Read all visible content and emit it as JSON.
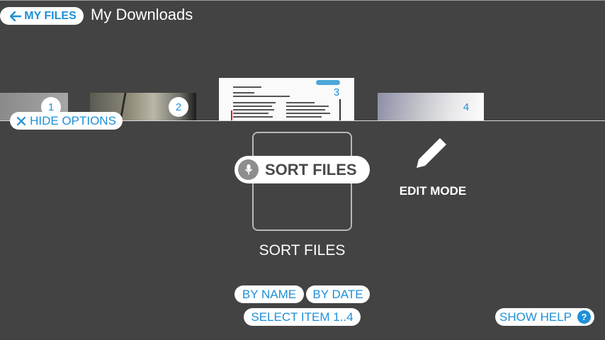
{
  "header": {
    "back_label": "MY FILES",
    "title": "My Downloads"
  },
  "thumbnails": [
    {
      "number": "1"
    },
    {
      "number": "2"
    },
    {
      "number": "3"
    },
    {
      "number": "4"
    }
  ],
  "options": {
    "hide_label": "HIDE OPTIONS",
    "voice_prompt": "SORT FILES",
    "sort_label": "SORT FILES",
    "edit_label": "EDIT MODE",
    "by_name": "BY NAME",
    "by_date": "BY DATE",
    "select_item": "SELECT ITEM 1..4",
    "show_help": "SHOW HELP",
    "help_glyph": "?"
  },
  "icons": {
    "back": "arrow-left-icon",
    "close": "close-icon",
    "mic": "microphone-icon",
    "edit": "pencil-icon",
    "help": "question-icon"
  },
  "colors": {
    "background": "#434343",
    "accent": "#1e8fd8"
  }
}
